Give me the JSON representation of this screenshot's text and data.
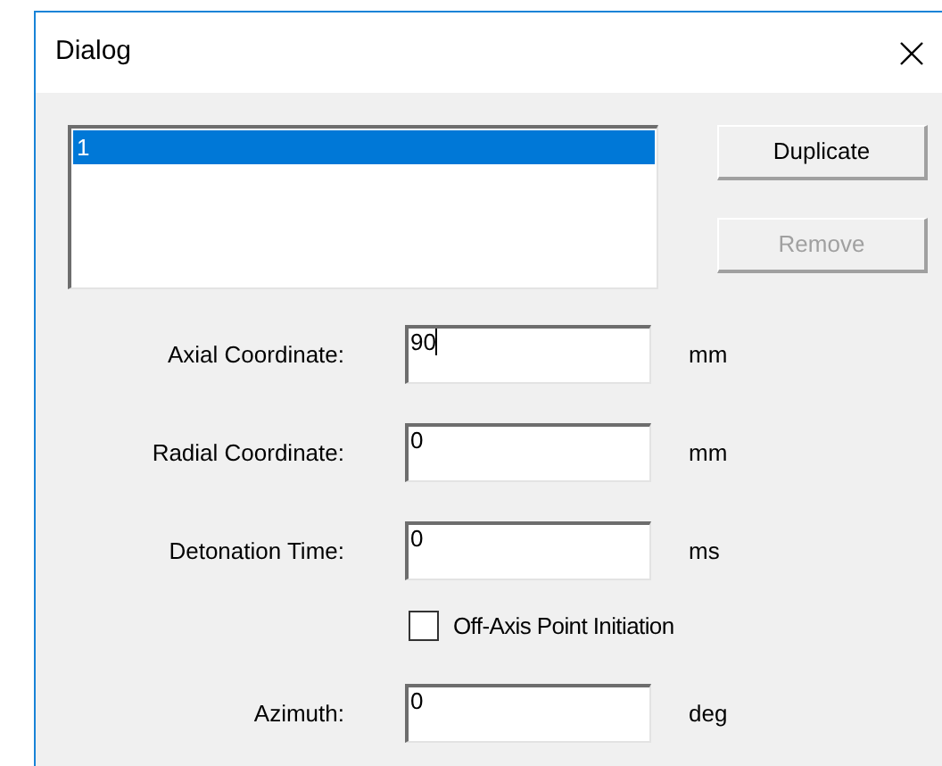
{
  "window": {
    "title": "Dialog"
  },
  "list": {
    "items": [
      {
        "text": "1",
        "selected": true
      }
    ]
  },
  "buttons": [
    {
      "label": "Duplicate",
      "disabled": false
    },
    {
      "label": "Remove",
      "disabled": true
    }
  ],
  "rows": [
    {
      "kind": "field",
      "label": "Axial Coordinate:",
      "value": "90",
      "unit": "mm",
      "focused": true
    },
    {
      "kind": "field",
      "label": "Radial Coordinate:",
      "value": "0",
      "unit": "mm",
      "focused": false
    },
    {
      "kind": "field",
      "label": "Detonation Time:",
      "value": "0",
      "unit": "ms",
      "focused": false
    },
    {
      "kind": "checkbox",
      "label": "Off-Axis Point Initiation",
      "checked": false
    },
    {
      "kind": "field",
      "label": "Azimuth:",
      "value": "0",
      "unit": "deg",
      "focused": false
    }
  ]
}
